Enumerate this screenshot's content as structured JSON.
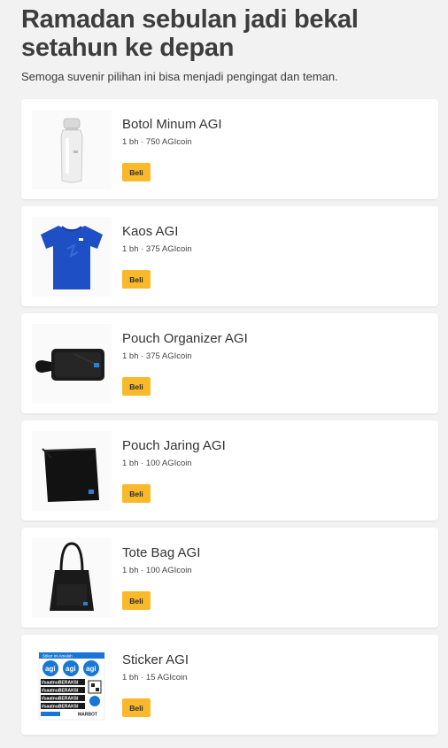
{
  "header": {
    "title_line1": "Ramadan sebulan jadi bekal",
    "title_line2": "setahun ke depan",
    "subtitle": "Semoga suvenir pilihan ini bisa menjadi pengingat dan teman."
  },
  "products": [
    {
      "name": "Botol Minum AGI",
      "meta": "1 bh · 750 AGIcoin",
      "button": "Beli",
      "image": "water-bottle"
    },
    {
      "name": "Kaos AGI",
      "meta": "1 bh · 375 AGIcoin",
      "button": "Beli",
      "image": "tshirt"
    },
    {
      "name": "Pouch Organizer AGI",
      "meta": "1 bh · 375 AGIcoin",
      "button": "Beli",
      "image": "pouch-organizer"
    },
    {
      "name": "Pouch Jaring AGI",
      "meta": "1 bh · 100 AGIcoin",
      "button": "Beli",
      "image": "mesh-pouch"
    },
    {
      "name": "Tote Bag AGI",
      "meta": "1 bh · 100 AGIcoin",
      "button": "Beli",
      "image": "tote-bag"
    },
    {
      "name": "Sticker AGI",
      "meta": "1 bh · 15 AGIcoin",
      "button": "Beli",
      "image": "sticker-sheet"
    }
  ],
  "sticker_sheet": {
    "header": "Stiker Ini Amalah",
    "logo": "agi",
    "hashtag": "#saatnuBERAKSI",
    "footer_brand": "MARBOT"
  },
  "colors": {
    "accent": "#f9b92a",
    "background": "#f2f2f2",
    "card": "#ffffff",
    "shirt_blue": "#1f4fc4",
    "sticker_blue": "#1877d6"
  }
}
